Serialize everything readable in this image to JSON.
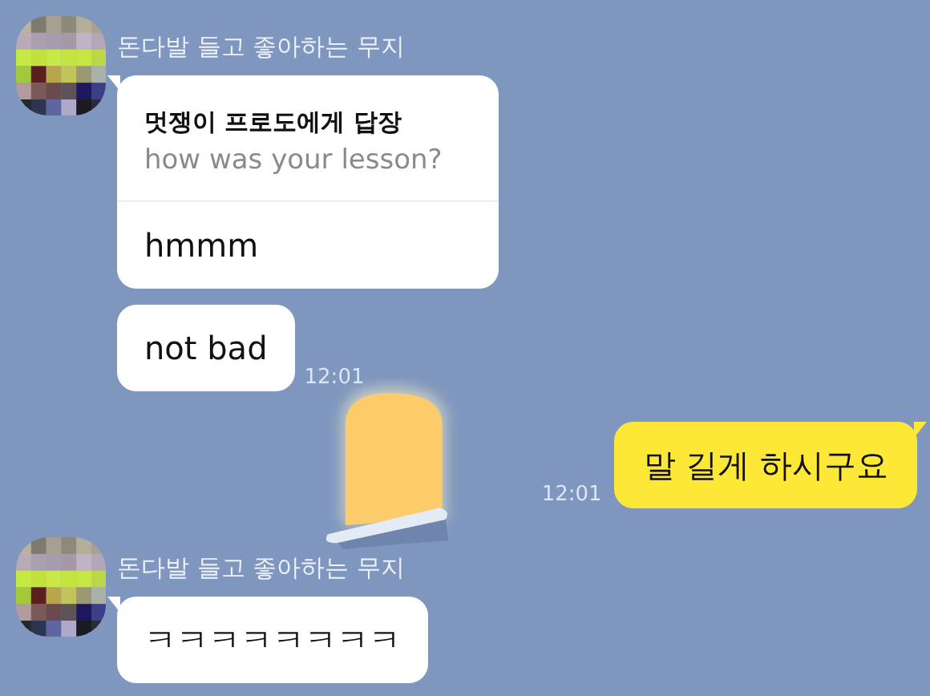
{
  "messages": [
    {
      "kind": "incoming",
      "sender": "돈다발 들고 좋아하는 무지",
      "reply": {
        "title": "멋쟁이 프로도에게 답장",
        "quote": "how was your lesson?"
      },
      "text": "hmmm"
    },
    {
      "kind": "incoming",
      "text": "not bad",
      "time": "12:01"
    },
    {
      "kind": "sticker"
    },
    {
      "kind": "outgoing",
      "text": "말 길게 하시구요",
      "time": "12:01"
    },
    {
      "kind": "incoming",
      "sender": "돈다발 들고 좋아하는 무지",
      "text": "ㅋㅋㅋㅋㅋㅋㅋㅋ"
    }
  ]
}
